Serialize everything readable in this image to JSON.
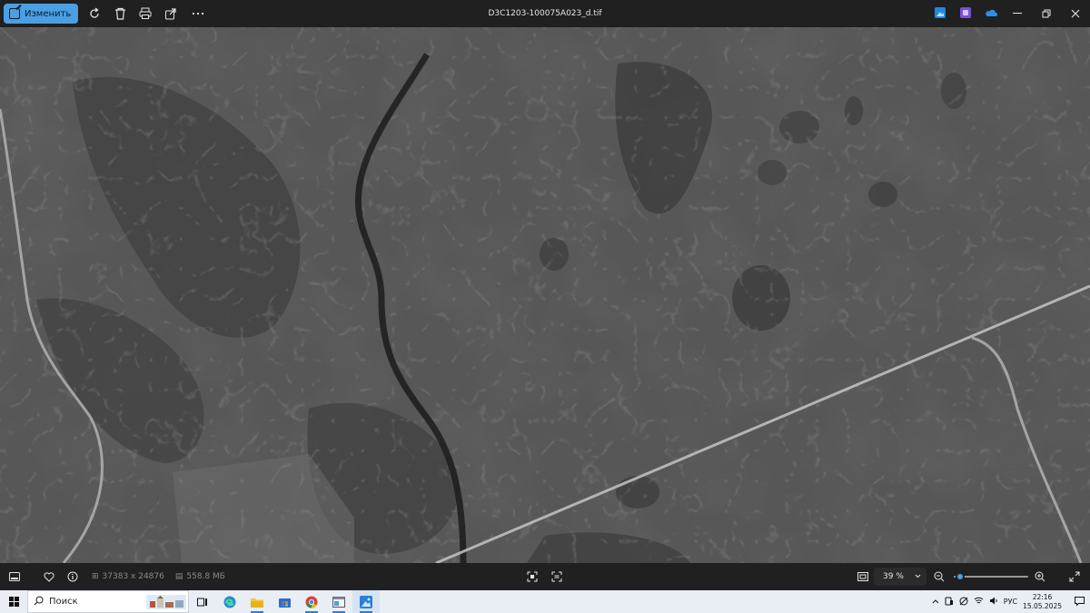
{
  "titlebar": {
    "edit_label": "Изменить",
    "title": "D3C1203-100075A023_d.tif",
    "icons": [
      "rotate-icon",
      "delete-icon",
      "print-icon",
      "share-icon",
      "more-icon"
    ],
    "app_icons": [
      "photos-editor-icon",
      "clipchamp-icon",
      "onedrive-icon"
    ],
    "controls": [
      "minimize-icon",
      "restore-icon",
      "close-icon"
    ]
  },
  "statusbar": {
    "dimensions": "37383 x 24876",
    "filesize": "558.8 МБ",
    "zoom": "39 %",
    "zoom_fraction": 0.08
  },
  "taskbar": {
    "search_placeholder": "Поиск",
    "apps": [
      "task-view-icon",
      "edge-icon",
      "file-explorer-icon",
      "store-icon",
      "chrome-icon",
      "window-app-icon",
      "photos-icon"
    ],
    "language": "РУС",
    "time": "22:16",
    "date": "15.05.2025"
  },
  "colors": {
    "accent": "#4b9fe3",
    "chrome": "#202020",
    "taskbar": "#e9eef5"
  }
}
